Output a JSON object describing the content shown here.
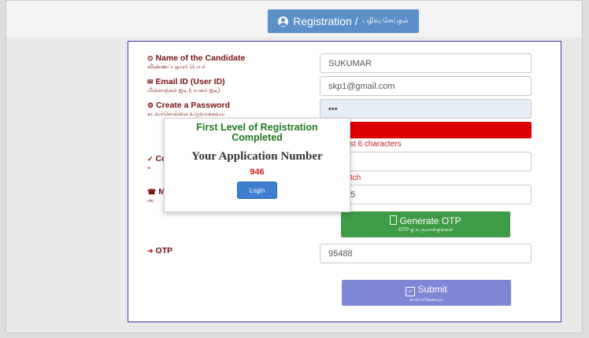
{
  "header": {
    "registration_label": "Registration /",
    "registration_tamil": "பதிவு செய்தல்"
  },
  "form": {
    "name": {
      "label": "Name of the Candidate",
      "sub": "விண்ணப்பதாரர் பெயர்",
      "value": "SUKUMAR"
    },
    "email": {
      "label": "Email ID (User ID)",
      "sub": "மின்னஞ்சல் ஐடி (பயனர் ஐடி)",
      "value": "skp1@gmail.com"
    },
    "password": {
      "label": "Create a Password",
      "sub": "கடவுச்சொல்லை உருவாக்கவும்",
      "value": "•••",
      "hint": "d atleast 6 characters"
    },
    "confirm": {
      "label_fragment": "Cc",
      "sub_fragment": "க",
      "hint": "Match"
    },
    "mobile": {
      "label_fragment": "M",
      "sub_fragment": "அ",
      "value": ")52245"
    },
    "otp": {
      "label": "OTP",
      "value": "95488"
    }
  },
  "buttons": {
    "generate_otp": "Generate OTP",
    "generate_otp_tamil": "OTP ஐ உருவாக்குங்கள்",
    "submit": "Submit",
    "submit_tamil": "சமர்ப்பிக்கவும்"
  },
  "modal": {
    "title_line1": "First Level of Registration",
    "title_line2": "Completed",
    "app_label": "Your Application Number",
    "app_number": "946",
    "login": "Login"
  },
  "colors": {
    "header_button": "#5a8fc7",
    "error_bar": "#dd0000",
    "generate_otp": "#3f9b45",
    "submit": "#7f86d6",
    "modal_title": "#1e7a1e",
    "app_number": "#cc2222"
  }
}
